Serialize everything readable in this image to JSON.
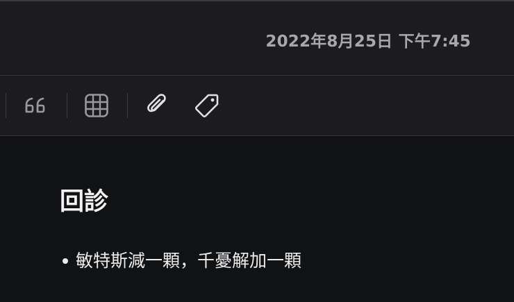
{
  "header": {
    "timestamp": "2022年8月25日 下午7:45"
  },
  "toolbar": {
    "tools": [
      {
        "name": "quote",
        "icon": "quote-icon"
      },
      {
        "name": "table",
        "icon": "table-icon"
      },
      {
        "name": "attachment",
        "icon": "paperclip-icon"
      },
      {
        "name": "tag",
        "icon": "tag-icon"
      }
    ]
  },
  "note": {
    "title": "回診",
    "bullets": [
      "敏特斯減一顆，千憂解加一顆"
    ]
  },
  "colors": {
    "background": "#111214",
    "panel": "#1c1c1e",
    "icon": "#9a9a9c",
    "text": "#ececec",
    "timestamp": "#a8a8aa"
  }
}
